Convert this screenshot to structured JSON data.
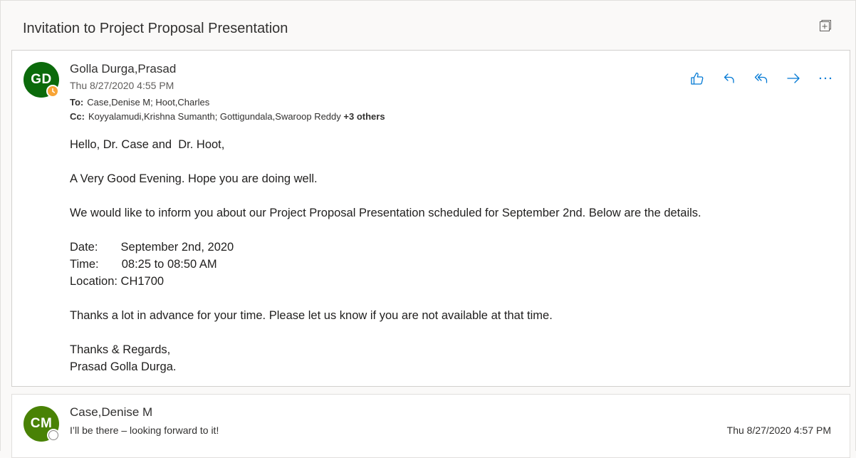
{
  "subject": "Invitation to Project Proposal Presentation",
  "colors": {
    "accent": "#0078d4",
    "avatar_gd": "#0b6a0b",
    "avatar_cm": "#498205",
    "presence_away": "#f8a435"
  },
  "message1": {
    "avatar_initials": "GD",
    "sender": "Golla Durga,Prasad",
    "date": "Thu 8/27/2020 4:55 PM",
    "to_label": "To:",
    "to": "Case,Denise M; Hoot,Charles",
    "cc_label": "Cc:",
    "cc": "Koyyalamudi,Krishna Sumanth; Gottigundala,Swaroop Reddy",
    "cc_more": "+3 others",
    "actions": [
      {
        "icon": "like-icon"
      },
      {
        "icon": "reply-icon"
      },
      {
        "icon": "reply-all-icon"
      },
      {
        "icon": "forward-icon"
      },
      {
        "icon": "more-icon"
      }
    ],
    "body": {
      "greeting": "Hello, Dr. Case and  Dr. Hoot,",
      "line1": "A Very Good Evening. Hope you are doing well.",
      "line2": "We would like to inform you about our Project Proposal Presentation scheduled for September 2nd. Below are the details.",
      "date_line": "Date:       September 2nd, 2020",
      "time_line": "Time:       08:25 to 08:50 AM",
      "location_line": "Location: CH1700",
      "line3": "Thanks a lot in advance for your time. Please let us know if you are not available at that time.",
      "closing": "Thanks & Regards,",
      "signature": "Prasad Golla Durga."
    }
  },
  "message2": {
    "avatar_initials": "CM",
    "sender": "Case,Denise M",
    "preview": "I’ll be there – looking forward to it!",
    "date": "Thu 8/27/2020 4:57 PM"
  }
}
